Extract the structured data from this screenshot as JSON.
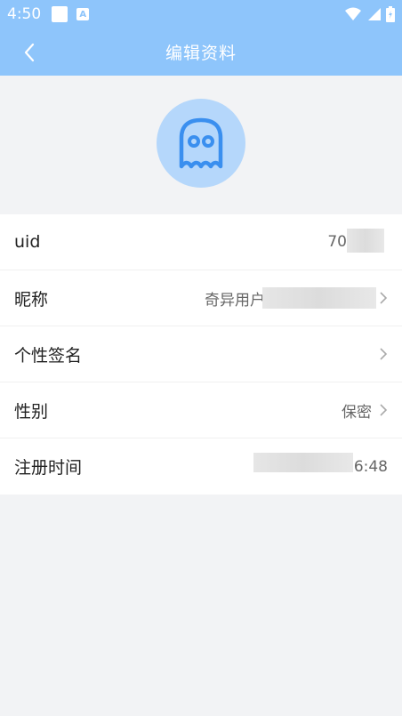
{
  "status_bar": {
    "time": "4:50",
    "badge": "A"
  },
  "header": {
    "title": "编辑资料"
  },
  "profile": {
    "rows": [
      {
        "label": "uid",
        "value": "70"
      },
      {
        "label": "昵称",
        "value": "奇异用户"
      },
      {
        "label": "个性签名",
        "value": ""
      },
      {
        "label": "性别",
        "value": "保密"
      },
      {
        "label": "注册时间",
        "value": "16:48"
      }
    ]
  },
  "colors": {
    "accent": "#8ec5fb",
    "avatar_bg": "#b5d7fb",
    "avatar_icon": "#3a8fef"
  }
}
